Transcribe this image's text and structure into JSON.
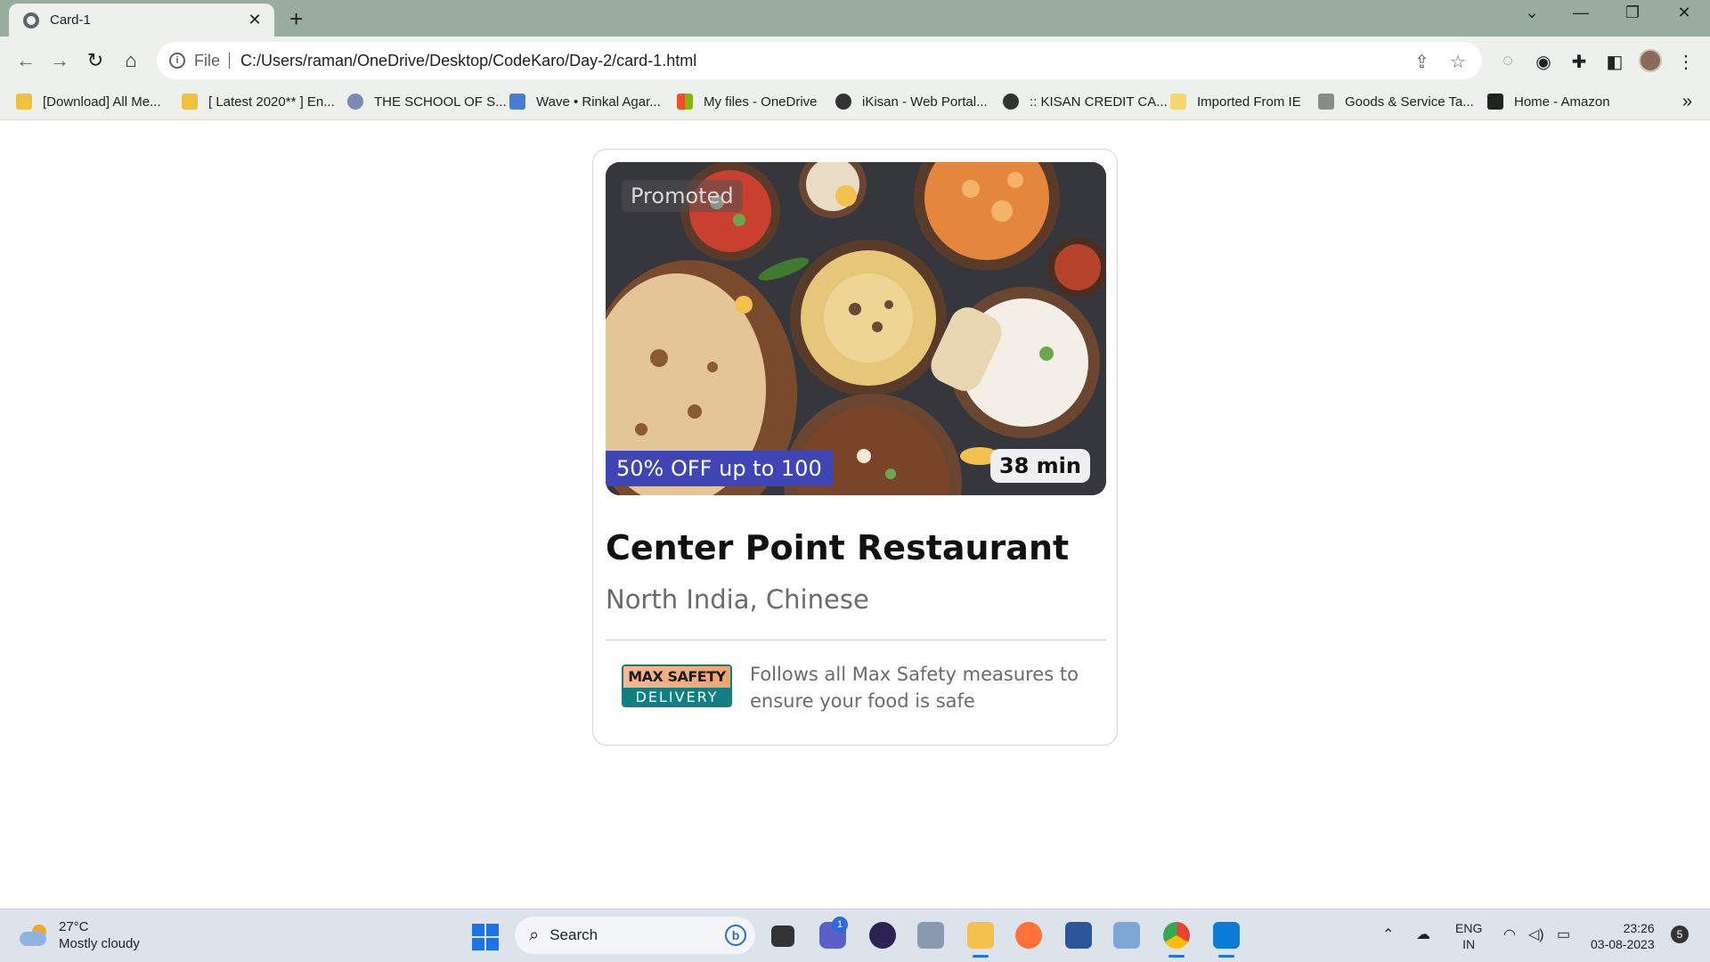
{
  "browser": {
    "tab_title": "Card-1",
    "close_glyph": "✕",
    "new_tab_glyph": "+",
    "scheme_label": "File",
    "url": "C:/Users/raman/OneDrive/Desktop/CodeKaro/Day-2/card-1.html",
    "bookmarks": [
      {
        "label": "[Download] All Me...",
        "icon": "bookmark-favicon",
        "color": "#f0c040"
      },
      {
        "label": "[ Latest 2020** ] En...",
        "icon": "bookmark-favicon",
        "color": "#f0c040"
      },
      {
        "label": "THE SCHOOL OF S...",
        "icon": "gear-favicon",
        "color": "#7a8ab5"
      },
      {
        "label": "Wave • Rinkal Agar...",
        "icon": "wave-favicon",
        "color": "#4a7bd6"
      },
      {
        "label": "My files - OneDrive",
        "icon": "microsoft-favicon",
        "color": "#f25022"
      },
      {
        "label": "iKisan - Web Portal...",
        "icon": "globe-favicon",
        "color": "#333333"
      },
      {
        "label": ":: KISAN CREDIT CA...",
        "icon": "globe-favicon",
        "color": "#333333"
      },
      {
        "label": "Imported From IE",
        "icon": "folder-icon",
        "color": "#f5d76e"
      },
      {
        "label": "Goods & Service Ta...",
        "icon": "emblem-favicon",
        "color": "#8a8a8a"
      },
      {
        "label": "Home - Amazon",
        "icon": "amazon-favicon",
        "color": "#222222"
      }
    ],
    "more_bookmarks_glyph": "»"
  },
  "card": {
    "promoted": "Promoted",
    "offer": "50% OFF up to 100",
    "delivery_time": "38 min",
    "restaurant_name": "Center Point Restaurant",
    "cuisine": "North India, Chinese",
    "safety_logo_top": "MAX SAFETY",
    "safety_logo_bottom": "DELIVERY",
    "safety_text": "Follows all Max Safety measures to ensure your food is safe"
  },
  "taskbar": {
    "temperature": "27°C",
    "weather": "Mostly cloudy",
    "search_label": "Search",
    "chat_badge": "1",
    "lang_line1": "ENG",
    "lang_line2": "IN",
    "time": "23:26",
    "date": "03-08-2023",
    "notifications": "5"
  }
}
